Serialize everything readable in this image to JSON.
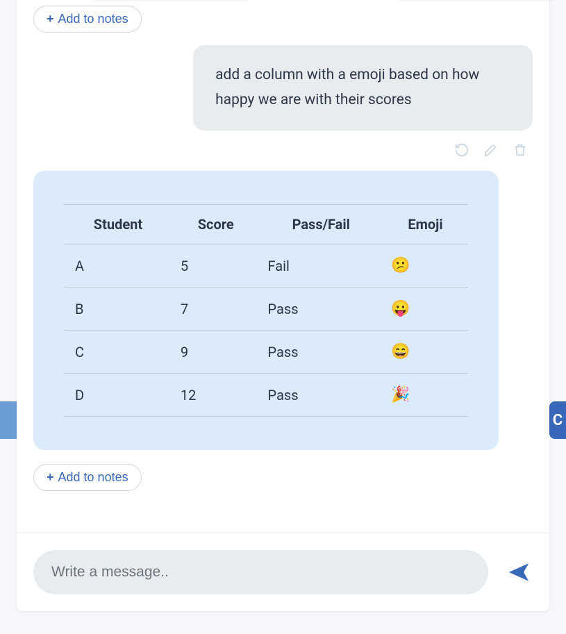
{
  "add_to_notes_label": "Add to notes",
  "user_message": "add a column with a emoji based on how happy we are with their scores",
  "table": {
    "headers": [
      "Student",
      "Score",
      "Pass/Fail",
      "Emoji"
    ],
    "rows": [
      {
        "student": "A",
        "score": "5",
        "passfail": "Fail",
        "emoji": "😕"
      },
      {
        "student": "B",
        "score": "7",
        "passfail": "Pass",
        "emoji": "😛"
      },
      {
        "student": "C",
        "score": "9",
        "passfail": "Pass",
        "emoji": "😄"
      },
      {
        "student": "D",
        "score": "12",
        "passfail": "Pass",
        "emoji": "🎉"
      }
    ]
  },
  "composer": {
    "placeholder": "Write a message.."
  },
  "right_edge_glyph": "C"
}
